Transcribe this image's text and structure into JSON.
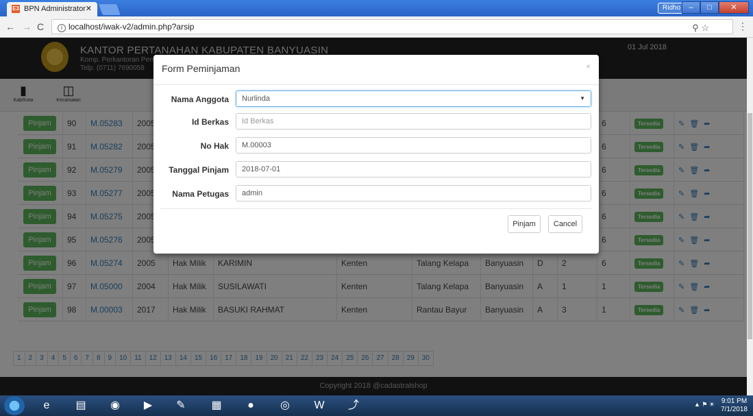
{
  "browser": {
    "tab_title": "BPN Administrator",
    "tab_favicon": "E3",
    "url": "localhost/iwak-v2/admin.php?arsip",
    "user_badge": "Ridho"
  },
  "header": {
    "office_name": "KANTOR PERTANAHAN KABUPATEN BANYUASIN",
    "address": "Komp. Perkantoran Pemkab B",
    "phone": "Telp. (0711) 7690058",
    "date": "01 Jul 2018"
  },
  "icon_nav": [
    {
      "label": "Kab/Kota",
      "icon": "book-icon"
    },
    {
      "label": "Kecamatan",
      "icon": "map-icon"
    }
  ],
  "table": {
    "action_label": "Pinjam",
    "rows": [
      {
        "no": "90",
        "hak_no": "M.05283",
        "year": "2005",
        "jenis": "",
        "nama": "",
        "desa": "",
        "kec": "",
        "kab": "",
        "blok": "",
        "lemari": "",
        "rak": "6",
        "status": "Tersedia"
      },
      {
        "no": "91",
        "hak_no": "M.05282",
        "year": "2005",
        "jenis": "",
        "nama": "",
        "desa": "",
        "kec": "",
        "kab": "",
        "blok": "",
        "lemari": "",
        "rak": "6",
        "status": "Tersedia"
      },
      {
        "no": "92",
        "hak_no": "M.05279",
        "year": "2005",
        "jenis": "",
        "nama": "",
        "desa": "",
        "kec": "",
        "kab": "",
        "blok": "",
        "lemari": "",
        "rak": "6",
        "status": "Tersedia"
      },
      {
        "no": "93",
        "hak_no": "M.05277",
        "year": "2005",
        "jenis": "",
        "nama": "",
        "desa": "",
        "kec": "",
        "kab": "",
        "blok": "",
        "lemari": "",
        "rak": "6",
        "status": "Tersedia"
      },
      {
        "no": "94",
        "hak_no": "M.05275",
        "year": "2005",
        "jenis": "",
        "nama": "",
        "desa": "",
        "kec": "",
        "kab": "",
        "blok": "",
        "lemari": "",
        "rak": "6",
        "status": "Tersedia"
      },
      {
        "no": "95",
        "hak_no": "M.05276",
        "year": "2005",
        "jenis": "",
        "nama": "",
        "desa": "",
        "kec": "",
        "kab": "",
        "blok": "",
        "lemari": "",
        "rak": "6",
        "status": "Tersedia"
      },
      {
        "no": "96",
        "hak_no": "M.05274",
        "year": "2005",
        "jenis": "Hak Milik",
        "nama": "KARIMIN",
        "desa": "Kenten",
        "kec": "Talang Kelapa",
        "kab": "Banyuasin",
        "blok": "D",
        "lemari": "2",
        "rak": "6",
        "status": "Tersedia"
      },
      {
        "no": "97",
        "hak_no": "M.05000",
        "year": "2004",
        "jenis": "Hak Milik",
        "nama": "SUSILAWATI",
        "desa": "Kenten",
        "kec": "Talang Kelapa",
        "kab": "Banyuasin",
        "blok": "A",
        "lemari": "1",
        "rak": "1",
        "status": "Tersedia"
      },
      {
        "no": "98",
        "hak_no": "M.00003",
        "year": "2017",
        "jenis": "Hak Milik",
        "nama": "BASUKI RAHMAT",
        "desa": "Kenten",
        "kec": "Rantau Bayur",
        "kab": "Banyuasin",
        "blok": "A",
        "lemari": "3",
        "rak": "1",
        "status": "Tersedia"
      }
    ]
  },
  "pagination": [
    "1",
    "2",
    "3",
    "4",
    "5",
    "6",
    "7",
    "8",
    "9",
    "10",
    "11",
    "12",
    "13",
    "14",
    "15",
    "16",
    "17",
    "18",
    "19",
    "20",
    "21",
    "22",
    "23",
    "24",
    "25",
    "26",
    "27",
    "28",
    "29",
    "30"
  ],
  "footer": {
    "text": "Copyright 2018 @cadastralshop"
  },
  "modal": {
    "title": "Form Peminjaman",
    "close": "×",
    "fields": {
      "nama_anggota": {
        "label": "Nama Anggota",
        "value": "Nurlinda"
      },
      "id_berkas": {
        "label": "Id Berkas",
        "placeholder": "Id Berkas"
      },
      "no_hak": {
        "label": "No Hak",
        "value": "M.00003"
      },
      "tanggal_pinjam": {
        "label": "Tanggal Pinjam",
        "value": "2018-07-01"
      },
      "nama_petugas": {
        "label": "Nama Petugas",
        "value": "admin"
      }
    },
    "submit_label": "Pinjam",
    "cancel_label": "Cancel"
  },
  "taskbar": {
    "time": "9:01 PM",
    "date": "7/1/2018"
  },
  "colors": {
    "success": "#5cb85c",
    "link": "#337ab7",
    "header_bg": "#222222"
  }
}
